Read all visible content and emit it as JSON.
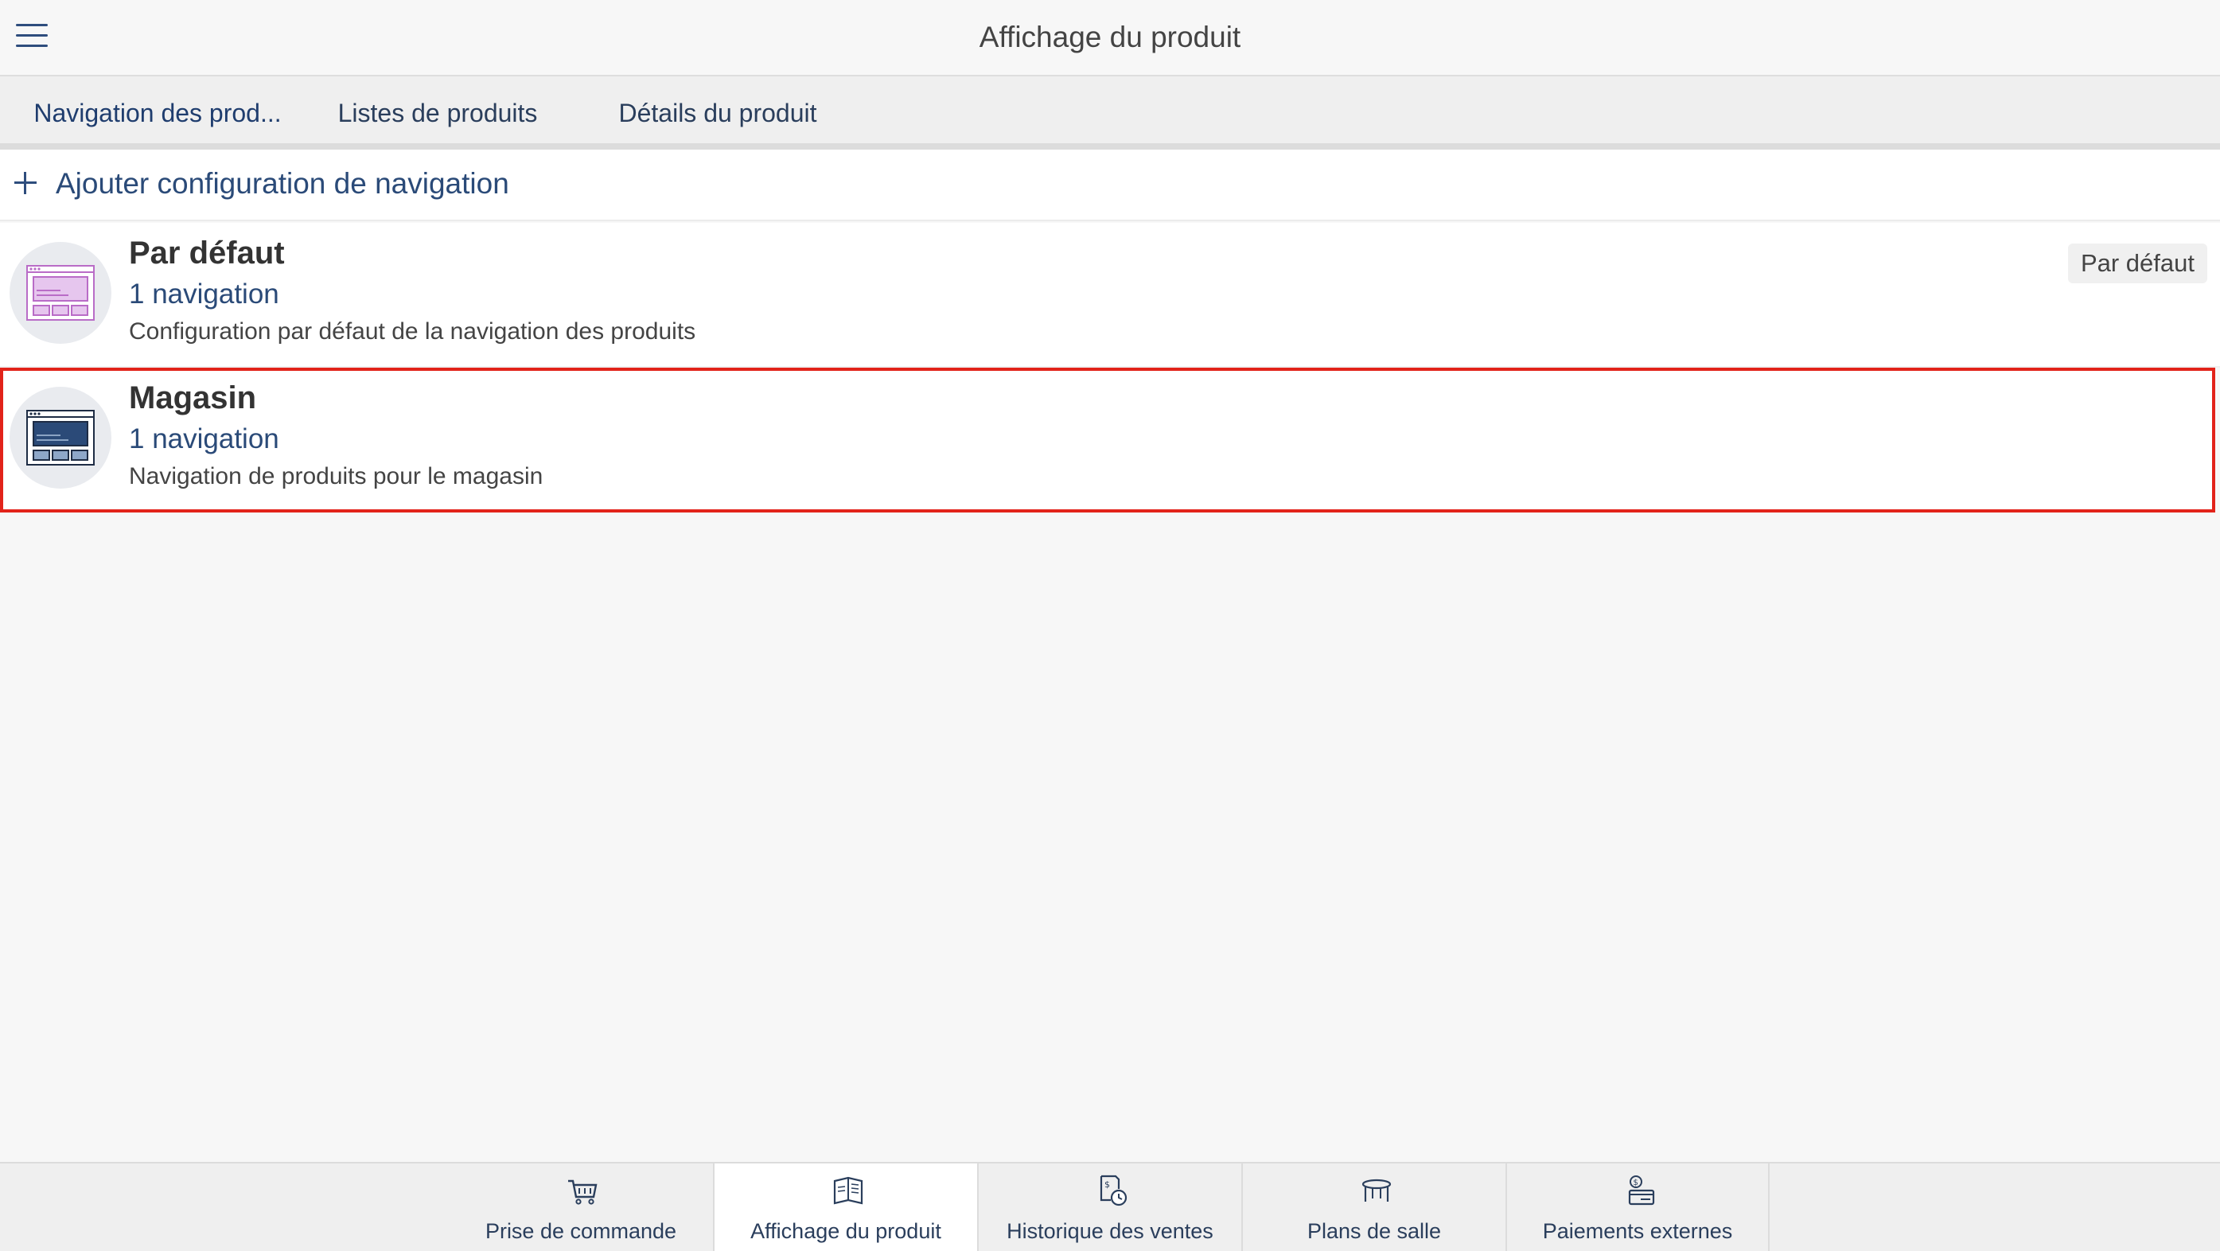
{
  "header": {
    "title": "Affichage du produit",
    "menu_icon": "hamburger-menu-icon"
  },
  "tabs": [
    {
      "label": "Navigation des prod...",
      "active": true
    },
    {
      "label": "Listes de produits",
      "active": false
    },
    {
      "label": "Détails du produit",
      "active": false
    }
  ],
  "add_action": {
    "label": "Ajouter configuration de navigation",
    "icon": "plus-icon"
  },
  "configurations": [
    {
      "title": "Par défaut",
      "subtitle": "1 navigation",
      "description": "Configuration par défaut de la navigation des produits",
      "badge": "Par défaut",
      "icon": "window-layout-icon",
      "icon_color": "#e6c6ee"
    },
    {
      "title": "Magasin",
      "subtitle": "1 navigation",
      "description": "Navigation de produits pour le magasin",
      "icon": "window-layout-icon",
      "icon_color": "#2b4a78",
      "highlighted": true
    }
  ],
  "bottom_nav": [
    {
      "label": "Prise de commande",
      "icon": "cart-icon",
      "active": false
    },
    {
      "label": "Affichage du produit",
      "icon": "menu-book-icon",
      "active": true
    },
    {
      "label": "Historique des ventes",
      "icon": "sales-history-icon",
      "active": false
    },
    {
      "label": "Plans de salle",
      "icon": "table-icon",
      "active": false
    },
    {
      "label": "Paiements externes",
      "icon": "external-payment-icon",
      "active": false
    }
  ],
  "colors": {
    "accent": "#2e4d7d",
    "highlight_border": "#e2231a"
  }
}
